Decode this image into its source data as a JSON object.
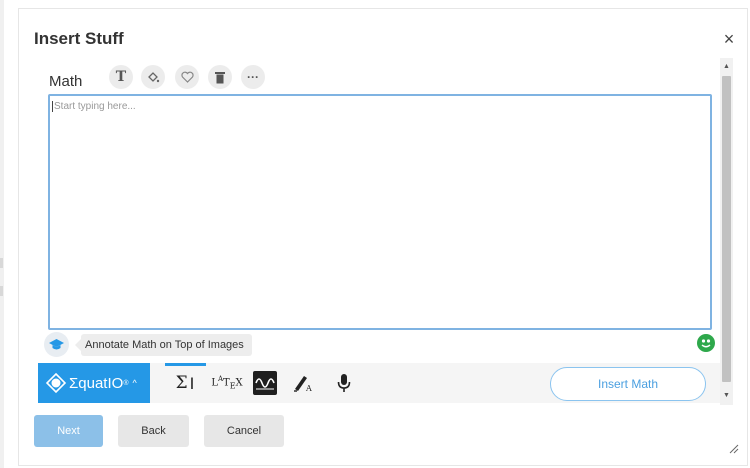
{
  "dialog": {
    "title": "Insert Stuff",
    "close_symbol": "×"
  },
  "editor": {
    "label": "Math",
    "placeholder": "Start typing here...",
    "toolbar_icons": [
      "text-format-icon",
      "fill-color-icon",
      "heart-icon",
      "trash-icon",
      "more-icon"
    ],
    "more_symbol": "···",
    "text_symbol": "T"
  },
  "annotate": {
    "label": "Annotate Math on Top of Images"
  },
  "equatio": {
    "brand": "ΣquatIO",
    "brand_mark": "®",
    "chevron": "^",
    "tools": [
      "equation-editor-icon",
      "latex-icon",
      "graph-icon",
      "handwriting-icon",
      "microphone-icon"
    ],
    "insert_label": "Insert Math"
  },
  "footer": {
    "next_label": "Next",
    "back_label": "Back",
    "cancel_label": "Cancel"
  },
  "colors": {
    "accent": "#2598e6",
    "editor_border": "#7fb3e2",
    "next_button": "#8cc0e8"
  }
}
